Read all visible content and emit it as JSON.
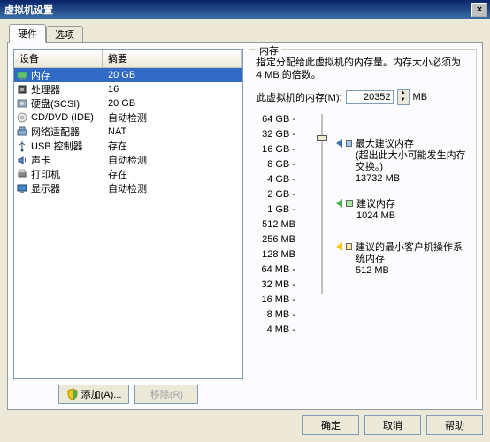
{
  "window": {
    "title": "虚拟机设置"
  },
  "close": "×",
  "tabs": {
    "hardware": "硬件",
    "options": "选项"
  },
  "list": {
    "header_device": "设备",
    "header_summary": "摘要",
    "rows": [
      {
        "name": "内存",
        "summary": "20 GB",
        "icon": "mem"
      },
      {
        "name": "处理器",
        "summary": "16",
        "icon": "cpu"
      },
      {
        "name": "硬盘(SCSI)",
        "summary": "20 GB",
        "icon": "disk"
      },
      {
        "name": "CD/DVD (IDE)",
        "summary": "自动检测",
        "icon": "cd"
      },
      {
        "name": "网络适配器",
        "summary": "NAT",
        "icon": "net"
      },
      {
        "name": "USB 控制器",
        "summary": "存在",
        "icon": "usb"
      },
      {
        "name": "声卡",
        "summary": "自动检测",
        "icon": "snd"
      },
      {
        "name": "打印机",
        "summary": "存在",
        "icon": "prn"
      },
      {
        "name": "显示器",
        "summary": "自动检测",
        "icon": "disp"
      }
    ]
  },
  "buttons": {
    "add": "添加(A)...",
    "remove": "移除(R)"
  },
  "mem": {
    "group_title": "内存",
    "desc": "指定分配给此虚拟机的内存量。内存大小必须为 4 MB 的倍数。",
    "label": "此虚拟机的内存(M):",
    "value": "20352",
    "unit": "MB",
    "ticks": [
      "64 GB",
      "32 GB",
      "16 GB",
      "8 GB",
      "4 GB",
      "2 GB",
      "1 GB",
      "512 MB",
      "256 MB",
      "128 MB",
      "64 MB",
      "32 MB",
      "16 MB",
      "8 MB",
      "4 MB"
    ],
    "max_rec_label": "最大建议内存",
    "max_rec_note": "(超出此大小可能发生内存交换。)",
    "max_rec_val": "13732 MB",
    "rec_label": "建议内存",
    "rec_val": "1024 MB",
    "min_label": "建议的最小客户机操作系统内存",
    "min_val": "512 MB"
  },
  "dlg_btns": {
    "ok": "确定",
    "cancel": "取消",
    "help": "帮助"
  }
}
